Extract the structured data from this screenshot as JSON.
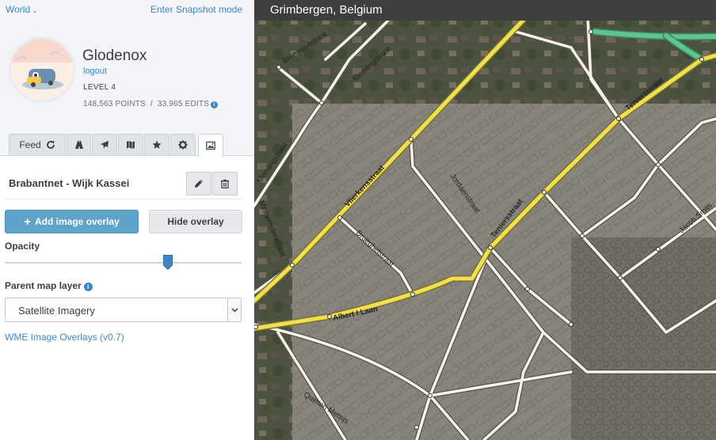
{
  "topbar": {
    "world_label": "World",
    "snapshot_label": "Enter Snapshot mode"
  },
  "user": {
    "name": "Glodenox",
    "logout_label": "logout",
    "level": "LEVEL 4",
    "stats": "148,563 POINTS  /  33,965 EDITS"
  },
  "tabs": [
    {
      "label": "Feed",
      "icon": "refresh-icon"
    },
    {
      "icon": "road-icon"
    },
    {
      "icon": "plane-icon"
    },
    {
      "icon": "map-icon"
    },
    {
      "icon": "star-icon"
    },
    {
      "icon": "gear-icon"
    },
    {
      "icon": "image-icon",
      "active": true
    }
  ],
  "panel": {
    "overlay_name": "Brabantnet - Wijk Kassei",
    "add_overlay_label": "Add image overlay",
    "hide_overlay_label": "Hide overlay",
    "opacity_label": "Opacity",
    "opacity_value": 0.69,
    "parent_layer_label": "Parent map layer",
    "parent_layer_value": "Satellite Imagery",
    "plugin_link": "WME Image Overlays (v0.7)"
  },
  "map": {
    "location": "Grimbergen, Belgium",
    "streets": [
      "Breemputstraat",
      "Memlingstraat",
      "Memlingstraat",
      "Vlierkensstraat",
      "Jordaenstraat",
      "Teniersstraat",
      "Teniersstraat",
      "Brueghelstraat",
      "Albert I Laan",
      "Minnemolenstraat",
      "Jacob Smits",
      "Quinten Metsijs"
    ],
    "colors": {
      "primary_road": "#f0e050",
      "street": "#f6f3ea",
      "highway": "#5fc48f",
      "satellite": "#4a4f3e",
      "overlay": "#8a8580"
    }
  }
}
